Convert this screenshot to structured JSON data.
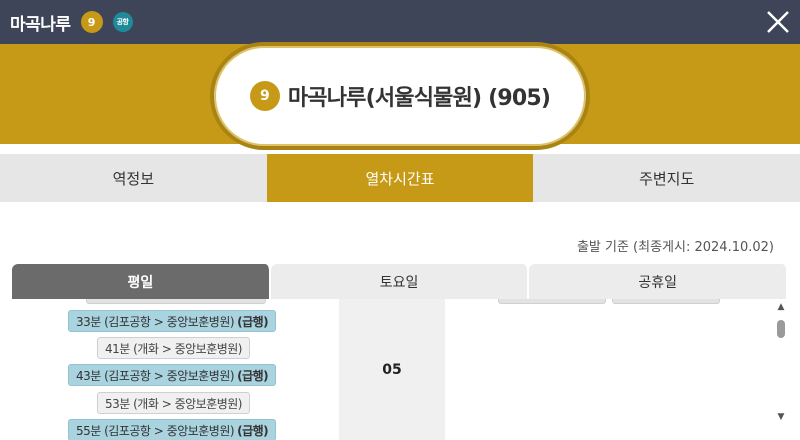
{
  "titlebar": {
    "title": "마곡나루",
    "line_badge": "9",
    "airport_badge": "공항",
    "close_icon": "close-x-icon"
  },
  "station": {
    "line_number": "9",
    "name": "마곡나루(서울식물원) (905)"
  },
  "main_tabs": [
    {
      "label": "역정보",
      "active": false
    },
    {
      "label": "열차시간표",
      "active": true
    },
    {
      "label": "주변지도",
      "active": false
    }
  ],
  "basis_text": "출발 기준 (최종게시: 2024.10.02)",
  "day_tabs": [
    {
      "label": "평일",
      "active": true
    },
    {
      "label": "토요일",
      "active": false
    },
    {
      "label": "공휴일",
      "active": false
    }
  ],
  "timetable": {
    "hour": "05",
    "entries": [
      {
        "text": "33분 (김포공항 > 중앙보훈병원)",
        "tag": "(급행)",
        "type": "express"
      },
      {
        "text": "41분 (개화 > 중앙보훈병원)",
        "tag": "",
        "type": "local"
      },
      {
        "text": "43분 (김포공항 > 중앙보훈병원)",
        "tag": "(급행)",
        "type": "express"
      },
      {
        "text": "53분 (개화 > 중앙보훈병원)",
        "tag": "",
        "type": "local"
      },
      {
        "text": "55분 (김포공항 > 중앙보훈병원)",
        "tag": "(급행)",
        "type": "express"
      }
    ]
  },
  "colors": {
    "titlebar_bg": "#3f4558",
    "accent_gold": "#c69a17",
    "airport_teal": "#1f8a9a",
    "express_bg": "#a9d3df",
    "local_bg": "#f0f0f0"
  }
}
